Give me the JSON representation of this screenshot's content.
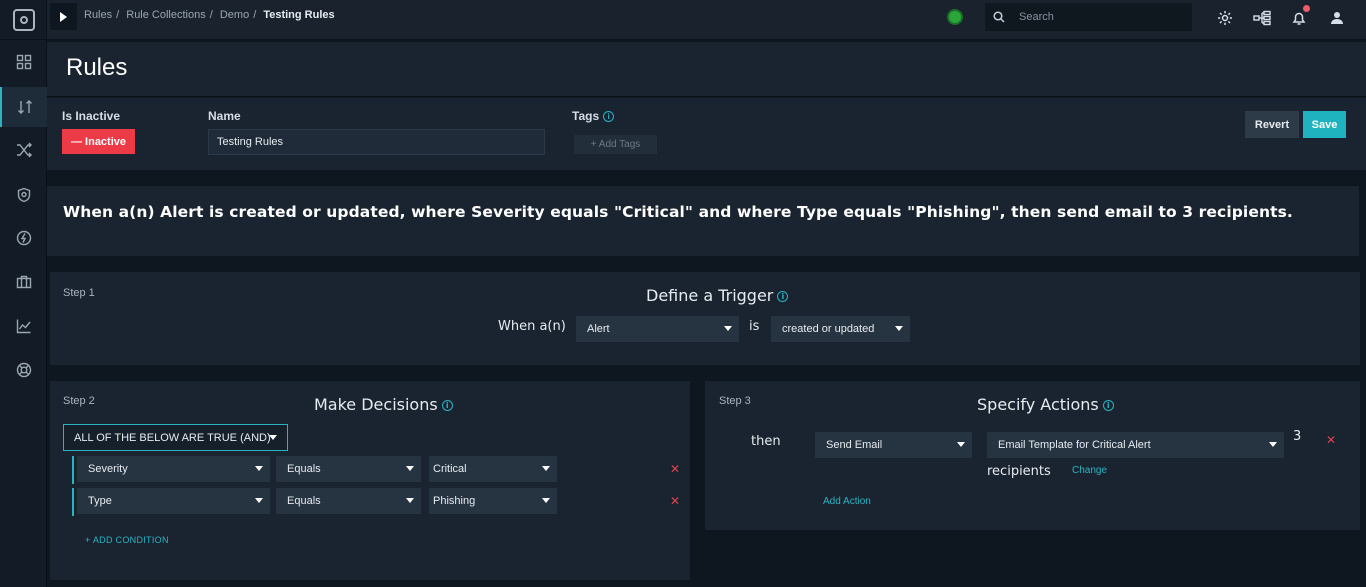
{
  "breadcrumb": {
    "items": [
      "Rules",
      "Rule Collections",
      "Demo"
    ],
    "current": "Testing Rules"
  },
  "search": {
    "placeholder": "Search"
  },
  "page": {
    "title": "Rules"
  },
  "form": {
    "is_inactive_label": "Is Inactive",
    "inactive_button": "— Inactive",
    "name_label": "Name",
    "name_value": "Testing Rules",
    "tags_label": "Tags",
    "add_tags": "+ Add Tags",
    "revert": "Revert",
    "save": "Save"
  },
  "summary": "When a(n) Alert is created or updated, where Severity equals \"Critical\" and where Type equals \"Phishing\", then send email to 3 recipients.",
  "step1": {
    "label": "Step 1",
    "title": "Define a Trigger",
    "when_text": "When a(n)",
    "entity": "Alert",
    "is_text": "is",
    "event": "created or updated"
  },
  "step2": {
    "label": "Step 2",
    "title": "Make Decisions",
    "logic": "ALL OF THE BELOW ARE TRUE (AND)",
    "conditions": [
      {
        "field": "Severity",
        "operator": "Equals",
        "value": "Critical"
      },
      {
        "field": "Type",
        "operator": "Equals",
        "value": "Phishing"
      }
    ],
    "add_condition": "+ ADD CONDITION"
  },
  "step3": {
    "label": "Step 3",
    "title": "Specify Actions",
    "then_text": "then",
    "action": "Send Email",
    "template": "Email Template for Critical Alert",
    "recipient_count": "3",
    "recipients_text": "recipients",
    "change_link": "Change",
    "add_action": "Add Action"
  },
  "colors": {
    "accent": "#29b4c4",
    "danger": "#ec3b47",
    "save": "#1fb3bf",
    "status_ok": "#2aa63a"
  }
}
